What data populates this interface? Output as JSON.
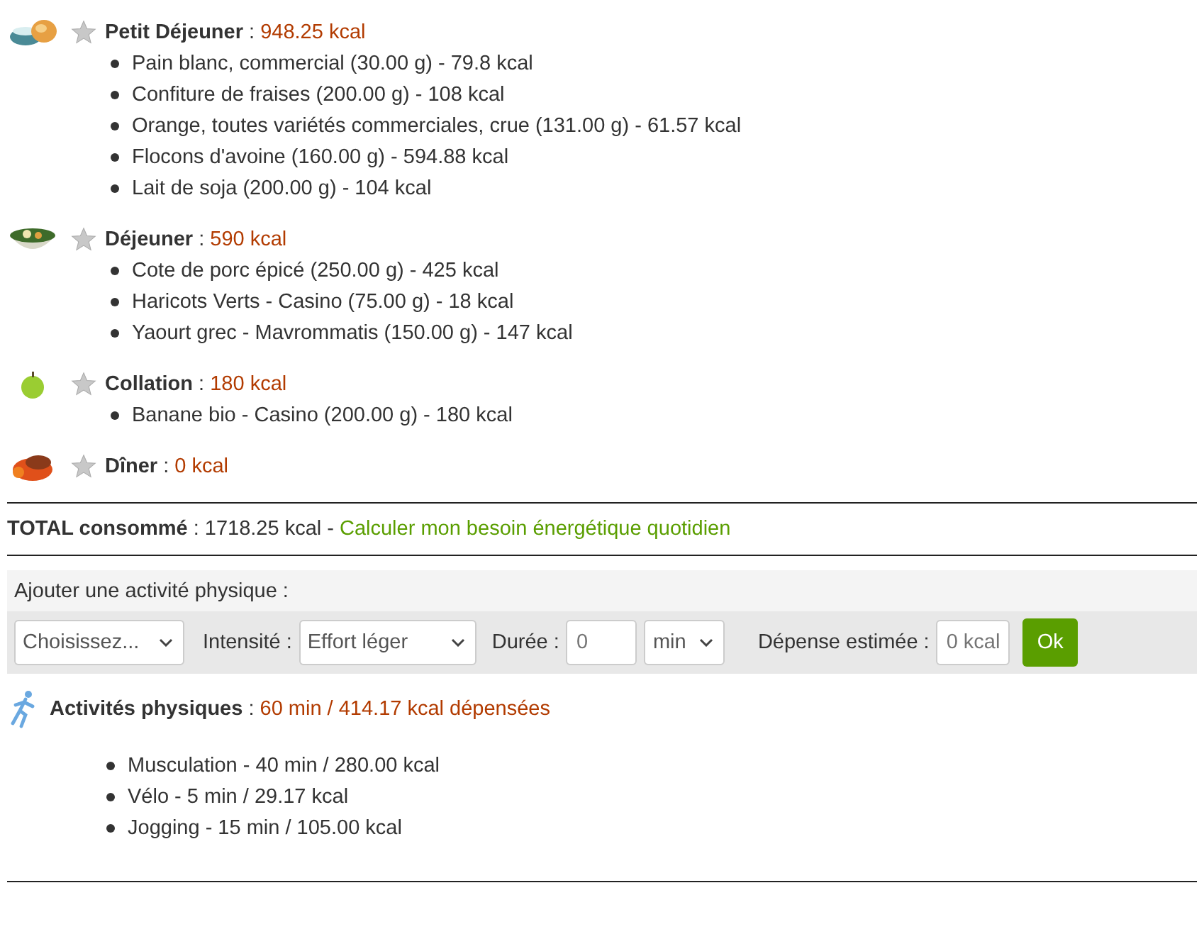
{
  "meals": [
    {
      "kind": "cup",
      "name": "**Petit Déjeuner** :",
      "kcal": "948.25 kcal",
      "items": [
        "Pain blanc, commercial (30.00 g) - 79.8 kcal",
        "Confiture de fraises (200.00 g) - 108 kcal",
        "Orange, toutes variétés commerciales, crue (131.00 g) - 61.57 kcal",
        "Flocons d'avoine (160.00 g) - 594.88 kcal",
        "Lait de soja (200.00 g) - 104 kcal"
      ]
    },
    {
      "kind": "bowl",
      "name": "**Déjeuner** :",
      "kcal": "590 kcal",
      "items": [
        "Cote de porc épicé (250.00 g) - 425 kcal",
        "Haricots Verts - Casino (75.00 g) - 18 kcal",
        "Yaourt grec - Mavrommatis (150.00 g) - 147 kcal"
      ]
    },
    {
      "kind": "apple",
      "name": "**Collation** :",
      "kcal": "180 kcal",
      "items": [
        "Banane bio - Casino (200.00 g) - 180 kcal"
      ]
    },
    {
      "kind": "pot",
      "name": "**Dîner** :",
      "kcal": "0 kcal"
    }
  ],
  "total": {
    "label": "**TOTAL consommé** : 1718.25 kcal -",
    "link": "Calculer mon besoin énergétique quotidien"
  },
  "add_activity": {
    "title": "Ajouter une activité physique :",
    "activity_select": "Choisissez...",
    "intensity_label": "Intensité :",
    "intensity_select": "Effort léger",
    "duration_label": "Durée :",
    "duration_placeholder": "0",
    "unit_select": "min",
    "estimate_label": "Dépense estimée :",
    "estimate_placeholder": "0 kcal",
    "ok_button": "Ok"
  },
  "activities": {
    "label": "**Activités physiques** :",
    "summary": "60 min / 414.17 kcal dépensées",
    "items": [
      "Musculation - 40 min / 280.00 kcal",
      "Vélo - 5 min / 29.17 kcal",
      "Jogging - 15 min / 105.00 kcal"
    ]
  }
}
